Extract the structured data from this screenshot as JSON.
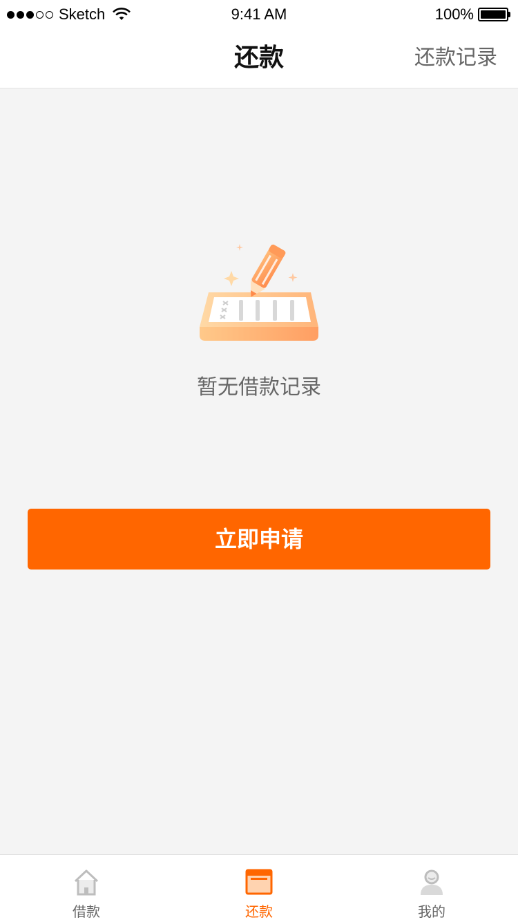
{
  "status_bar": {
    "carrier": "Sketch",
    "time": "9:41 AM",
    "battery": "100%"
  },
  "nav": {
    "title": "还款",
    "action": "还款记录"
  },
  "empty_state": {
    "text": "暂无借款记录",
    "icon": "pencil-notepad-icon"
  },
  "apply_button": {
    "label": "立即申请"
  },
  "colors": {
    "accent": "#ff6600",
    "background": "#f4f4f4"
  },
  "tabs": [
    {
      "label": "借款",
      "icon": "home-icon",
      "active": false
    },
    {
      "label": "还款",
      "icon": "repay-card-icon",
      "active": true
    },
    {
      "label": "我的",
      "icon": "person-icon",
      "active": false
    }
  ]
}
